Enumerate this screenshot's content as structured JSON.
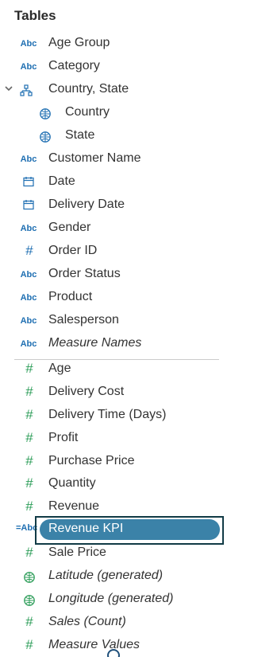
{
  "panel": {
    "title": "Tables",
    "dimensions": [
      {
        "icon": "abc",
        "label": "Age Group"
      },
      {
        "icon": "abc",
        "label": "Category"
      },
      {
        "icon": "hierarchy",
        "label": "Country, State"
      },
      {
        "icon": "globe",
        "label": "Country"
      },
      {
        "icon": "globe",
        "label": "State"
      },
      {
        "icon": "abc",
        "label": "Customer Name"
      },
      {
        "icon": "calendar",
        "label": "Date"
      },
      {
        "icon": "calendar",
        "label": "Delivery Date"
      },
      {
        "icon": "abc",
        "label": "Gender"
      },
      {
        "icon": "hash",
        "label": "Order ID"
      },
      {
        "icon": "abc",
        "label": "Order Status"
      },
      {
        "icon": "abc",
        "label": "Product"
      },
      {
        "icon": "abc",
        "label": "Salesperson"
      },
      {
        "icon": "abc",
        "label": "Measure Names"
      }
    ],
    "measures": [
      {
        "icon": "hash",
        "label": "Age"
      },
      {
        "icon": "hash",
        "label": "Delivery Cost"
      },
      {
        "icon": "hash",
        "label": "Delivery Time (Days)"
      },
      {
        "icon": "hash",
        "label": "Profit"
      },
      {
        "icon": "hash",
        "label": "Purchase Price"
      },
      {
        "icon": "hash",
        "label": "Quantity"
      },
      {
        "icon": "hash",
        "label": "Revenue"
      },
      {
        "icon": "calc-abc",
        "label": "Revenue KPI"
      },
      {
        "icon": "hash",
        "label": "Sale Price"
      },
      {
        "icon": "globe",
        "label": "Latitude (generated)"
      },
      {
        "icon": "globe",
        "label": "Longitude (generated)"
      },
      {
        "icon": "hash",
        "label": "Sales (Count)"
      },
      {
        "icon": "hash",
        "label": "Measure Values"
      }
    ],
    "icon_text": {
      "abc": "Abc",
      "calc_abc": "=Abc",
      "hash": "#"
    },
    "colors": {
      "blue_icon": "#1f6fb2",
      "green_icon": "#2e9e5a",
      "selected_pill": "#3b82a8",
      "outline": "#123b46"
    }
  }
}
